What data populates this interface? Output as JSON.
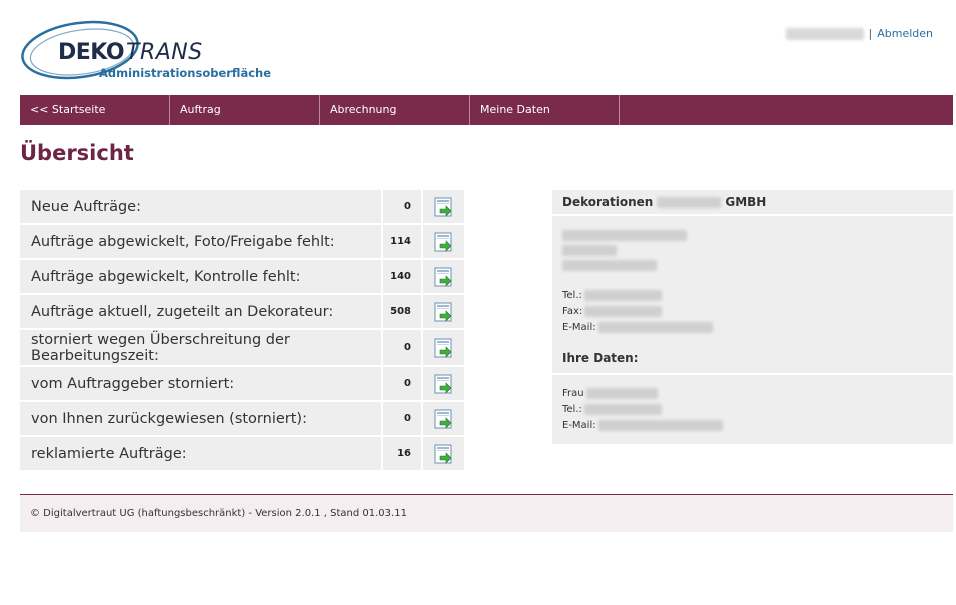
{
  "brand": {
    "name_bold": "DEKO",
    "name_italic": "TRANS",
    "subtitle": "Administrationsoberfläche"
  },
  "header": {
    "separator": "|",
    "logout_label": "Abmelden"
  },
  "nav": {
    "items": [
      {
        "label": "<< Startseite"
      },
      {
        "label": "Auftrag"
      },
      {
        "label": "Abrechnung"
      },
      {
        "label": "Meine Daten"
      }
    ]
  },
  "page": {
    "title": "Übersicht"
  },
  "status": {
    "rows": [
      {
        "label": "Neue Aufträge:",
        "count": "0"
      },
      {
        "label": "Aufträge abgewickelt, Foto/Freigabe fehlt:",
        "count": "114"
      },
      {
        "label": "Aufträge abgewickelt, Kontrolle fehlt:",
        "count": "140"
      },
      {
        "label": "Aufträge aktuell, zugeteilt an Dekorateur:",
        "count": "508"
      },
      {
        "label": "storniert wegen Überschreitung der Bearbeitungszeit:",
        "count": "0"
      },
      {
        "label": "vom Auftraggeber storniert:",
        "count": "0"
      },
      {
        "label": "von Ihnen zurückgewiesen (storniert):",
        "count": "0"
      },
      {
        "label": "reklamierte Aufträge:",
        "count": "16"
      }
    ]
  },
  "company": {
    "name_prefix": "Dekorationen",
    "name_suffix": "GMBH",
    "tel_label": "Tel.:",
    "fax_label": "Fax:",
    "email_label": "E-Mail:"
  },
  "your_data": {
    "heading": "Ihre Daten:",
    "salutation": "Frau",
    "tel_label": "Tel.:",
    "email_label": "E-Mail:"
  },
  "footer": {
    "text": "© Digitalvertraut UG (haftungsbeschränkt) - Version 2.0.1 , Stand 01.03.11"
  },
  "colors": {
    "brand_maroon": "#7a2a4a",
    "title_maroon": "#6e2443",
    "link_blue": "#2a6f9f",
    "panel_gray": "#eeeeee"
  },
  "icons": {
    "logo": "swoosh-logo-icon",
    "row_action": "go-arrow-icon"
  }
}
